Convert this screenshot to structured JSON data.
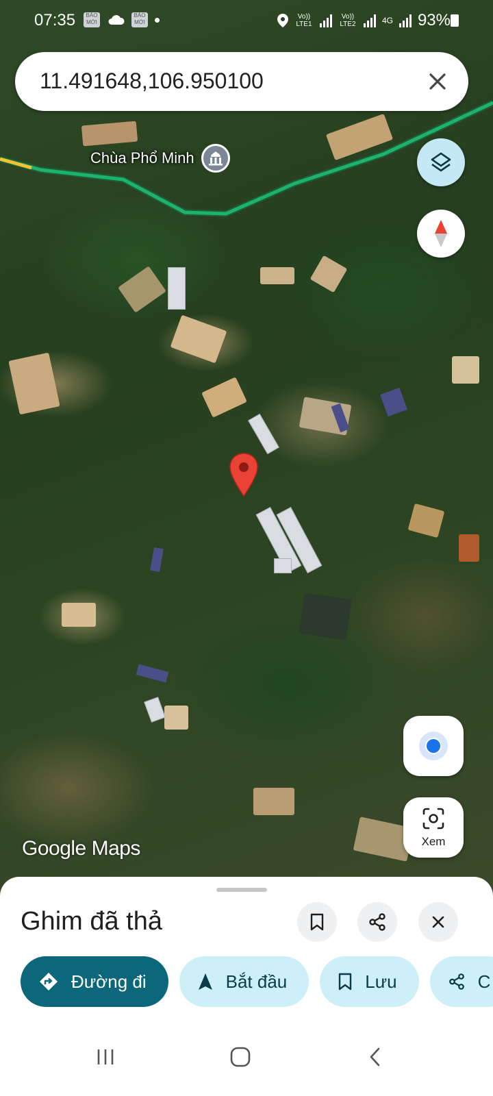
{
  "status_bar": {
    "time": "07:35",
    "badge1": "BÁO MỚI",
    "badge2": "BÁO MỚI",
    "sim1": "Vo)) LTE1",
    "sim2": "Vo)) LTE2",
    "network": "4G",
    "battery": "93%"
  },
  "search": {
    "value": "11.491648,106.950100"
  },
  "map": {
    "poi_label": "Chùa Phổ Minh",
    "watermark": "Google Maps",
    "pin_color": "#ea4335",
    "route_color": "#1db36a"
  },
  "fab": {
    "xem_label": "Xem"
  },
  "sheet": {
    "title": "Ghim đã thả",
    "chips": {
      "directions": "Đường đi",
      "start": "Bắt đầu",
      "save": "Lưu",
      "share": "C"
    }
  }
}
